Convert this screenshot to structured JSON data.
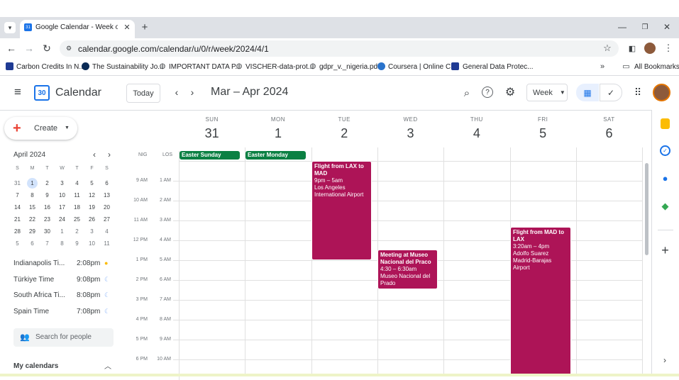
{
  "browser": {
    "tab_title": "Google Calendar - Week of Ma",
    "url": "calendar.google.com/calendar/u/0/r/week/2024/4/1",
    "bookmarks": [
      "Carbon Credits In N...",
      "The Sustainability Jo...",
      "IMPORTANT DATA P...",
      "VISCHER-data-prot...",
      "gdpr_v._nigeria.pdf",
      "Coursera | Online C...",
      "General Data Protec..."
    ],
    "all_bookmarks": "All Bookmarks"
  },
  "header": {
    "app_name": "Calendar",
    "logo_number": "30",
    "today_label": "Today",
    "date_range": "Mar – Apr 2024",
    "view_label": "Week"
  },
  "sidebar": {
    "create_label": "Create",
    "mini_month": "April 2024",
    "dow": [
      "S",
      "M",
      "T",
      "W",
      "T",
      "F",
      "S"
    ],
    "weeks": [
      [
        "31",
        "1",
        "2",
        "3",
        "4",
        "5",
        "6"
      ],
      [
        "7",
        "8",
        "9",
        "10",
        "11",
        "12",
        "13"
      ],
      [
        "14",
        "15",
        "16",
        "17",
        "18",
        "19",
        "20"
      ],
      [
        "21",
        "22",
        "23",
        "24",
        "25",
        "26",
        "27"
      ],
      [
        "28",
        "29",
        "30",
        "1",
        "2",
        "3",
        "4"
      ],
      [
        "5",
        "6",
        "7",
        "8",
        "9",
        "10",
        "11"
      ]
    ],
    "timezones": [
      {
        "name": "Indianapolis Ti...",
        "time": "2:08pm",
        "icon": "sun-icon"
      },
      {
        "name": "Türkiye Time",
        "time": "9:08pm",
        "icon": "moon-icon"
      },
      {
        "name": "South Africa Ti...",
        "time": "8:08pm",
        "icon": "moon-icon"
      },
      {
        "name": "Spain Time",
        "time": "7:08pm",
        "icon": "moon-icon"
      }
    ],
    "search_people": "Search for people",
    "my_calendars": "My calendars"
  },
  "grid": {
    "tz_labels": [
      "NIG",
      "LOS"
    ],
    "days": [
      {
        "dow": "SUN",
        "num": "31"
      },
      {
        "dow": "MON",
        "num": "1"
      },
      {
        "dow": "TUE",
        "num": "2"
      },
      {
        "dow": "WED",
        "num": "3"
      },
      {
        "dow": "THU",
        "num": "4"
      },
      {
        "dow": "FRI",
        "num": "5"
      },
      {
        "dow": "SAT",
        "num": "6"
      }
    ],
    "primary_times": [
      "9 AM",
      "10 AM",
      "11 AM",
      "12 PM",
      "1 PM",
      "2 PM",
      "3 PM",
      "4 PM",
      "5 PM",
      "6 PM"
    ],
    "secondary_times": [
      "1 AM",
      "2 AM",
      "3 AM",
      "4 AM",
      "5 AM",
      "6 AM",
      "7 AM",
      "8 AM",
      "9 AM",
      "10 AM"
    ],
    "all_day": [
      {
        "title": "Easter Sunday"
      },
      {
        "title": "Easter Monday"
      }
    ],
    "events": [
      {
        "title": "Flight from LAX to MAD",
        "time": "9pm – 5am",
        "location": "Los Angeles International Airport"
      },
      {
        "title": "Meeting at Museo Nacional del Praco",
        "time": "4:30 – 6:30am",
        "location": "Museo Nacional del Prado"
      },
      {
        "title": "Flight from MAD to LAX",
        "time": "3:20am – 4pm",
        "location": "Adolfo Suarez Madrid-Barajas Airport"
      }
    ]
  },
  "colors": {
    "event": "#ad1457",
    "holiday": "#0b8043",
    "accent": "#1a73e8"
  }
}
